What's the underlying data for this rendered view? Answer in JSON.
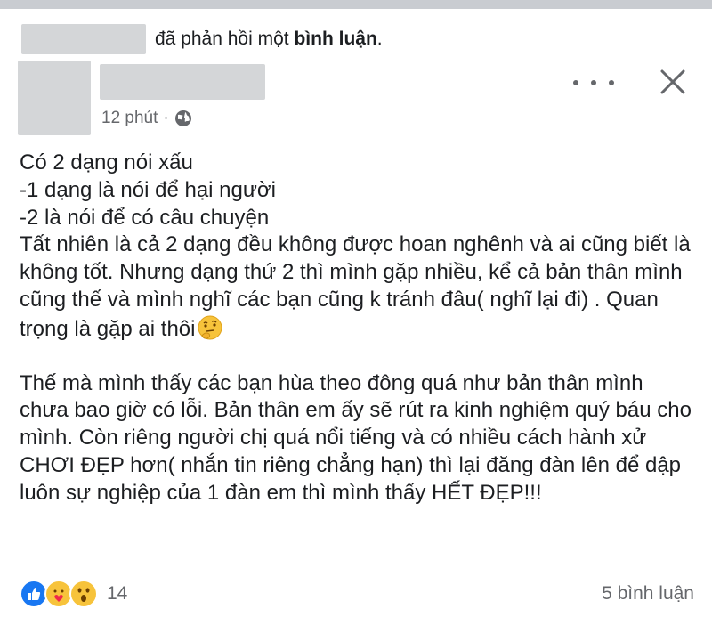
{
  "notification": {
    "text_prefix": "đã phản hồi một ",
    "text_bold": "bình luận",
    "text_suffix": "."
  },
  "post": {
    "time": "12 phút",
    "separator": "·",
    "privacy_icon": "globe-icon"
  },
  "body": {
    "paragraph1": "Có 2 dạng nói xấu\n-1 dạng là nói để hại người\n-2 là nói để có câu chuyện\nTất nhiên là cả 2 dạng đều không được hoan nghênh và ai cũng biết là không tốt. Nhưng dạng thứ 2 thì mình gặp nhiều, kể cả bản thân mình cũng thế và mình nghĩ các bạn cũng k tránh đâu( nghĩ lại đi) . Quan trọng là gặp ai thôi",
    "paragraph1_emoji": "thinking-face-icon",
    "paragraph2": "Thế mà mình thấy các bạn hùa theo đông quá như bản thân mình chưa bao giờ có lỗi. Bản thân em ấy sẽ rút ra kinh nghiệm quý báu cho mình. Còn riêng người chị quá nổi tiếng và có nhiều cách hành xử CHƠI ĐẸP hơn( nhắn tin riêng chẳng hạn) thì lại đăng đàn lên để dập luôn sự nghiệp của 1 đàn em thì mình thấy HẾT ĐẸP!!!"
  },
  "footer": {
    "reaction_icons": [
      "like-icon",
      "care-icon",
      "wow-icon"
    ],
    "reaction_count": "14",
    "comments": "5 bình luận"
  },
  "colors": {
    "like": "#1877f2",
    "emoji_yellow": "#f7c33b",
    "secondary_text": "#65676b"
  }
}
